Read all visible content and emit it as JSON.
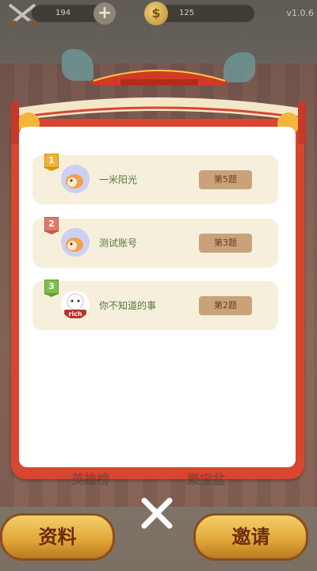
{
  "topbar": {
    "stat1": "194",
    "stat2": "125",
    "version": "v1.0.6",
    "plus_label": "+",
    "coin_symbol": "$"
  },
  "list": [
    {
      "rank": "1",
      "name": "一米阳光",
      "tag": "第5题",
      "rank_color": "#f2b233"
    },
    {
      "rank": "2",
      "name": "测试账号",
      "tag": "第3题",
      "rank_color": "#e07a6a"
    },
    {
      "rank": "3",
      "name": "你不知道的事",
      "tag": "第2题",
      "rank_color": "#7cc04a"
    }
  ],
  "avatar3_text": "rich",
  "bottom": {
    "left_hint": "英雄榜",
    "right_hint": "聚宝盆",
    "left_button": "资料",
    "right_button": "邀请"
  },
  "colors": {
    "panel_red": "#d8462f",
    "row_bg": "#f5efdc",
    "tag_bg": "#c9a27a",
    "name_green": "#557a3f"
  }
}
